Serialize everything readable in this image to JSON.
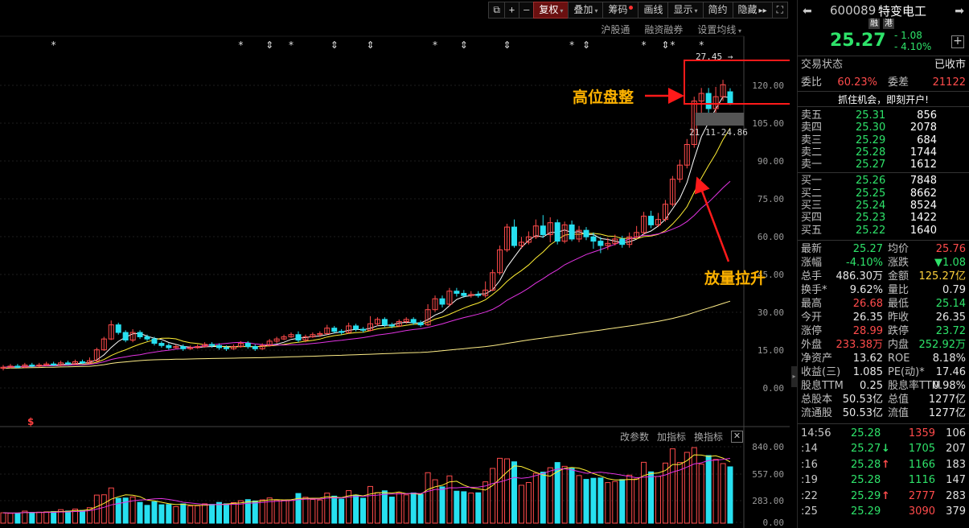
{
  "toolbar": {
    "buttons": [
      {
        "name": "lock",
        "label": "⧉",
        "icon": true
      },
      {
        "name": "zoom-in",
        "label": "+",
        "icon": true
      },
      {
        "name": "zoom-out",
        "label": "—",
        "icon": true
      },
      {
        "name": "fuquan",
        "label": "复权",
        "active": true,
        "caret": true
      },
      {
        "name": "overlay",
        "label": "叠加",
        "caret": true
      },
      {
        "name": "chip",
        "label": "筹码",
        "dot": true
      },
      {
        "name": "draw",
        "label": "画线"
      },
      {
        "name": "display",
        "label": "显示",
        "caret": true
      },
      {
        "name": "simple",
        "label": "简约"
      },
      {
        "name": "hide",
        "label": "隐藏",
        "suffix": "▸▸"
      },
      {
        "name": "fullscreen",
        "label": "⛶",
        "icon": true
      }
    ],
    "sub_links": [
      "沪股通",
      "融资融券",
      "设置均线"
    ]
  },
  "chart": {
    "y_ticks": [
      "120.00",
      "105.00",
      "90.00",
      "75.00",
      "60.00",
      "45.00",
      "30.00",
      "15.00",
      "0.00"
    ],
    "high_label": "27.45",
    "range_label": "21.11-24.86",
    "s_marker": "$",
    "volume_ticks": [
      "840.00",
      "557.00",
      "283.00",
      "0.00"
    ],
    "indicator_bar": [
      "改参数",
      "加指标",
      "换指标"
    ],
    "close_icon": "✕",
    "annotations": {
      "top": "高位盘整",
      "bottom": "放量拉升"
    },
    "colors": {
      "up": "#ff4b4b",
      "down": "#27e0f0",
      "ma5": "#ffffff",
      "ma10": "#ffee33",
      "ma20": "#e233e2",
      "ma60": "#ffee88"
    }
  },
  "chart_data": {
    "type": "candlestick",
    "candles": [
      [
        0.9,
        1.0,
        1.2,
        0.7
      ],
      [
        1.0,
        1.1,
        1.3,
        0.9
      ],
      [
        1.1,
        1.0,
        1.3,
        0.9
      ],
      [
        1.0,
        1.2,
        1.4,
        0.9
      ],
      [
        1.2,
        1.1,
        1.4,
        1.0
      ],
      [
        1.1,
        1.2,
        1.4,
        1.0
      ],
      [
        1.2,
        1.3,
        1.5,
        1.1
      ],
      [
        1.3,
        1.2,
        1.5,
        1.1
      ],
      [
        1.2,
        1.4,
        1.6,
        1.1
      ],
      [
        1.4,
        1.3,
        1.6,
        1.2
      ],
      [
        1.3,
        1.5,
        1.7,
        1.2
      ],
      [
        1.5,
        1.4,
        1.7,
        1.3
      ],
      [
        1.4,
        1.6,
        1.9,
        1.3
      ],
      [
        1.6,
        2.6,
        2.8,
        1.5
      ],
      [
        2.6,
        3.6,
        3.8,
        2.5
      ],
      [
        3.6,
        4.9,
        5.3,
        3.5
      ],
      [
        4.9,
        4.2,
        5.1,
        4.0
      ],
      [
        4.2,
        3.5,
        4.4,
        3.3
      ],
      [
        3.5,
        4.2,
        4.5,
        3.3
      ],
      [
        4.2,
        3.8,
        4.4,
        3.6
      ],
      [
        3.8,
        3.6,
        4.0,
        3.4
      ],
      [
        3.6,
        3.2,
        3.8,
        3.0
      ],
      [
        3.2,
        3.0,
        3.4,
        2.8
      ],
      [
        3.0,
        2.8,
        3.2,
        2.6
      ],
      [
        2.8,
        2.9,
        3.1,
        2.7
      ],
      [
        2.9,
        2.7,
        3.1,
        2.5
      ],
      [
        2.7,
        2.8,
        3.0,
        2.6
      ],
      [
        2.8,
        2.9,
        3.1,
        2.7
      ],
      [
        2.9,
        3.1,
        3.3,
        2.8
      ],
      [
        3.1,
        3.0,
        3.3,
        2.8
      ],
      [
        3.0,
        2.8,
        3.2,
        2.6
      ],
      [
        2.8,
        2.7,
        3.0,
        2.5
      ],
      [
        2.7,
        2.9,
        3.1,
        2.6
      ],
      [
        2.9,
        3.2,
        3.4,
        2.8
      ],
      [
        3.2,
        2.9,
        3.4,
        2.7
      ],
      [
        2.9,
        2.7,
        3.1,
        2.5
      ],
      [
        2.7,
        3.0,
        3.2,
        2.6
      ],
      [
        3.0,
        3.4,
        3.6,
        2.9
      ],
      [
        3.4,
        3.6,
        3.8,
        3.2
      ],
      [
        3.6,
        3.8,
        4.0,
        3.5
      ],
      [
        3.8,
        4.0,
        4.2,
        3.7
      ],
      [
        4.0,
        3.5,
        4.3,
        3.3
      ],
      [
        3.5,
        3.8,
        4.0,
        3.3
      ],
      [
        3.8,
        4.0,
        4.2,
        3.7
      ],
      [
        4.0,
        4.1,
        4.3,
        3.8
      ],
      [
        4.1,
        4.6,
        4.9,
        4.0
      ],
      [
        4.6,
        4.3,
        4.8,
        4.1
      ],
      [
        4.3,
        4.2,
        4.5,
        4.0
      ],
      [
        4.2,
        4.8,
        5.1,
        4.1
      ],
      [
        4.8,
        4.5,
        5.0,
        4.3
      ],
      [
        4.5,
        4.4,
        4.7,
        4.2
      ],
      [
        4.4,
        5.0,
        5.7,
        4.3
      ],
      [
        5.0,
        5.4,
        5.6,
        4.8
      ],
      [
        5.4,
        4.9,
        5.6,
        4.7
      ],
      [
        4.9,
        4.8,
        5.1,
        4.6
      ],
      [
        4.8,
        5.2,
        5.4,
        4.7
      ],
      [
        5.2,
        5.4,
        5.6,
        5.0
      ],
      [
        5.4,
        5.1,
        5.6,
        4.9
      ],
      [
        5.1,
        4.9,
        5.3,
        4.7
      ],
      [
        4.9,
        6.3,
        6.8,
        4.8
      ],
      [
        6.3,
        7.3,
        7.6,
        6.1
      ],
      [
        7.3,
        6.8,
        7.6,
        6.5
      ],
      [
        6.8,
        8.0,
        8.3,
        6.6
      ],
      [
        8.0,
        7.8,
        8.3,
        7.5
      ],
      [
        7.8,
        7.6,
        8.1,
        7.4
      ],
      [
        7.6,
        7.7,
        8.0,
        7.4
      ],
      [
        7.7,
        7.6,
        8.0,
        7.4
      ],
      [
        7.6,
        8.1,
        8.9,
        7.4
      ],
      [
        8.1,
        9.7,
        10.0,
        8.0
      ],
      [
        9.7,
        11.8,
        12.2,
        9.5
      ],
      [
        11.8,
        13.9,
        14.2,
        11.6
      ],
      [
        13.9,
        12.2,
        14.6,
        12.0
      ],
      [
        12.2,
        12.5,
        13.0,
        11.9
      ],
      [
        12.5,
        13.0,
        13.5,
        12.3
      ],
      [
        13.0,
        14.0,
        14.6,
        12.8
      ],
      [
        14.0,
        13.2,
        15.0,
        12.9
      ],
      [
        13.2,
        14.3,
        14.8,
        12.5
      ],
      [
        14.3,
        12.6,
        14.6,
        12.3
      ],
      [
        12.6,
        14.1,
        14.4,
        12.4
      ],
      [
        14.1,
        12.8,
        14.5,
        12.6
      ],
      [
        12.8,
        13.6,
        14.0,
        12.5
      ],
      [
        13.6,
        13.0,
        13.9,
        12.7
      ],
      [
        13.0,
        12.6,
        13.4,
        11.9
      ],
      [
        12.6,
        12.2,
        13.0,
        11.5
      ],
      [
        12.2,
        12.4,
        12.9,
        11.8
      ],
      [
        12.4,
        12.8,
        13.2,
        12.2
      ],
      [
        12.8,
        12.3,
        13.1,
        12.0
      ],
      [
        12.3,
        13.0,
        13.4,
        12.0
      ],
      [
        13.0,
        13.4,
        14.0,
        12.8
      ],
      [
        13.4,
        14.9,
        15.3,
        13.2
      ],
      [
        14.9,
        14.1,
        15.4,
        13.8
      ],
      [
        14.1,
        14.6,
        15.2,
        13.9
      ],
      [
        14.6,
        16.0,
        16.4,
        14.4
      ],
      [
        16.0,
        18.3,
        18.6,
        15.8
      ],
      [
        18.3,
        19.6,
        20.1,
        18.0
      ],
      [
        19.6,
        21.5,
        22.0,
        19.3
      ],
      [
        21.5,
        25.5,
        25.9,
        21.2
      ],
      [
        25.5,
        26.2,
        26.7,
        24.3
      ],
      [
        26.2,
        24.8,
        26.7,
        24.0
      ],
      [
        24.8,
        25.9,
        26.8,
        24.3
      ],
      [
        25.9,
        27.0,
        27.45,
        25.5
      ],
      [
        26.35,
        25.27,
        26.68,
        25.14
      ]
    ],
    "volume_max": 840
  },
  "quote": {
    "code": "600089",
    "name": "特变电工",
    "tags": [
      "融",
      "港"
    ],
    "price": "25.27",
    "change": "- 1.08",
    "change_pct": "- 4.10%",
    "back_icon": "⬅",
    "forward_icon": "➡",
    "plus_icon": "+",
    "status_label": "交易状态",
    "status_value": "已收市",
    "weibi_label": "委比",
    "weibi_value": "60.23%",
    "weicha_label": "委差",
    "weicha_value": "21122",
    "promo": "抓住机会，即刻开户!"
  },
  "orderbook": {
    "asks": [
      {
        "label": "卖五",
        "price": "25.31",
        "vol": "856"
      },
      {
        "label": "卖四",
        "price": "25.30",
        "vol": "2078"
      },
      {
        "label": "卖三",
        "price": "25.29",
        "vol": "684"
      },
      {
        "label": "卖二",
        "price": "25.28",
        "vol": "1744"
      },
      {
        "label": "卖一",
        "price": "25.27",
        "vol": "1612"
      }
    ],
    "bids": [
      {
        "label": "买一",
        "price": "25.26",
        "vol": "7848"
      },
      {
        "label": "买二",
        "price": "25.25",
        "vol": "8662"
      },
      {
        "label": "买三",
        "price": "25.24",
        "vol": "8524"
      },
      {
        "label": "买四",
        "price": "25.23",
        "vol": "1422"
      },
      {
        "label": "买五",
        "price": "25.22",
        "vol": "1640"
      }
    ]
  },
  "stats": [
    {
      "l1": "最新",
      "v1": "25.27",
      "c1": "green",
      "l2": "均价",
      "v2": "25.76",
      "c2": "red"
    },
    {
      "l1": "涨幅",
      "v1": "-4.10%",
      "c1": "green",
      "l2": "涨跌",
      "v2": "▼1.08",
      "c2": "green"
    },
    {
      "l1": "总手",
      "v1": "486.30万",
      "c1": "white",
      "l2": "金额",
      "v2": "125.27亿",
      "c2": "yellow"
    },
    {
      "l1": "换手*",
      "v1": "9.62%",
      "c1": "white",
      "l2": "量比",
      "v2": "0.79",
      "c2": "white"
    },
    {
      "l1": "最高",
      "v1": "26.68",
      "c1": "red",
      "l2": "最低",
      "v2": "25.14",
      "c2": "green"
    },
    {
      "l1": "今开",
      "v1": "26.35",
      "c1": "white",
      "l2": "昨收",
      "v2": "26.35",
      "c2": "white"
    },
    {
      "l1": "涨停",
      "v1": "28.99",
      "c1": "red",
      "l2": "跌停",
      "v2": "23.72",
      "c2": "green"
    },
    {
      "l1": "外盘",
      "v1": "233.38万",
      "c1": "red",
      "l2": "内盘",
      "v2": "252.92万",
      "c2": "green"
    },
    {
      "l1": "净资产",
      "v1": "13.62",
      "c1": "white",
      "l2": "ROE",
      "v2": "8.18%",
      "c2": "white"
    },
    {
      "l1": "收益(三)",
      "v1": "1.085",
      "c1": "white",
      "l2": "PE(动)*",
      "v2": "17.46",
      "c2": "white"
    },
    {
      "l1": "股息TTM",
      "v1": "0.25",
      "c1": "white",
      "l2": "股息率TTM",
      "v2": "0.98%",
      "c2": "white"
    },
    {
      "l1": "总股本",
      "v1": "50.53亿",
      "c1": "white",
      "l2": "总值",
      "v2": "1277亿",
      "c2": "white"
    },
    {
      "l1": "流通股",
      "v1": "50.53亿",
      "c1": "white",
      "l2": "流值",
      "v2": "1277亿",
      "c2": "white"
    }
  ],
  "ticks": [
    {
      "time": "14:56",
      "price": "25.28",
      "pc": "green",
      "arrow": "",
      "vol": "1359",
      "vc": "red",
      "cnt": "106"
    },
    {
      "time": ":14",
      "price": "25.27",
      "pc": "green",
      "arrow": "↓",
      "ac": "green",
      "vol": "1705",
      "vc": "green",
      "cnt": "207"
    },
    {
      "time": ":16",
      "price": "25.28",
      "pc": "green",
      "arrow": "↑",
      "ac": "red",
      "vol": "1166",
      "vc": "green",
      "cnt": "183"
    },
    {
      "time": ":19",
      "price": "25.28",
      "pc": "green",
      "arrow": "",
      "vol": "1116",
      "vc": "green",
      "cnt": "147"
    },
    {
      "time": ":22",
      "price": "25.29",
      "pc": "green",
      "arrow": "↑",
      "ac": "red",
      "vol": "2777",
      "vc": "red",
      "cnt": "283"
    },
    {
      "time": ":25",
      "price": "25.29",
      "pc": "green",
      "arrow": "",
      "vol": "3090",
      "vc": "red",
      "cnt": "379"
    }
  ]
}
